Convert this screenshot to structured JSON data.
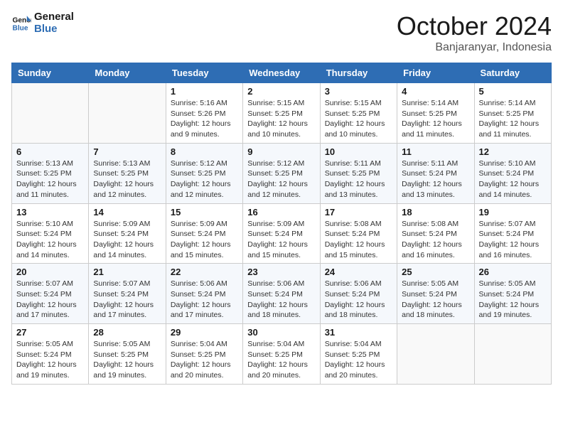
{
  "header": {
    "logo_general": "General",
    "logo_blue": "Blue",
    "month": "October 2024",
    "location": "Banjaranyar, Indonesia"
  },
  "weekdays": [
    "Sunday",
    "Monday",
    "Tuesday",
    "Wednesday",
    "Thursday",
    "Friday",
    "Saturday"
  ],
  "weeks": [
    [
      {
        "day": "",
        "sunrise": "",
        "sunset": "",
        "daylight": ""
      },
      {
        "day": "",
        "sunrise": "",
        "sunset": "",
        "daylight": ""
      },
      {
        "day": "1",
        "sunrise": "Sunrise: 5:16 AM",
        "sunset": "Sunset: 5:26 PM",
        "daylight": "Daylight: 12 hours and 9 minutes."
      },
      {
        "day": "2",
        "sunrise": "Sunrise: 5:15 AM",
        "sunset": "Sunset: 5:25 PM",
        "daylight": "Daylight: 12 hours and 10 minutes."
      },
      {
        "day": "3",
        "sunrise": "Sunrise: 5:15 AM",
        "sunset": "Sunset: 5:25 PM",
        "daylight": "Daylight: 12 hours and 10 minutes."
      },
      {
        "day": "4",
        "sunrise": "Sunrise: 5:14 AM",
        "sunset": "Sunset: 5:25 PM",
        "daylight": "Daylight: 12 hours and 11 minutes."
      },
      {
        "day": "5",
        "sunrise": "Sunrise: 5:14 AM",
        "sunset": "Sunset: 5:25 PM",
        "daylight": "Daylight: 12 hours and 11 minutes."
      }
    ],
    [
      {
        "day": "6",
        "sunrise": "Sunrise: 5:13 AM",
        "sunset": "Sunset: 5:25 PM",
        "daylight": "Daylight: 12 hours and 11 minutes."
      },
      {
        "day": "7",
        "sunrise": "Sunrise: 5:13 AM",
        "sunset": "Sunset: 5:25 PM",
        "daylight": "Daylight: 12 hours and 12 minutes."
      },
      {
        "day": "8",
        "sunrise": "Sunrise: 5:12 AM",
        "sunset": "Sunset: 5:25 PM",
        "daylight": "Daylight: 12 hours and 12 minutes."
      },
      {
        "day": "9",
        "sunrise": "Sunrise: 5:12 AM",
        "sunset": "Sunset: 5:25 PM",
        "daylight": "Daylight: 12 hours and 12 minutes."
      },
      {
        "day": "10",
        "sunrise": "Sunrise: 5:11 AM",
        "sunset": "Sunset: 5:25 PM",
        "daylight": "Daylight: 12 hours and 13 minutes."
      },
      {
        "day": "11",
        "sunrise": "Sunrise: 5:11 AM",
        "sunset": "Sunset: 5:24 PM",
        "daylight": "Daylight: 12 hours and 13 minutes."
      },
      {
        "day": "12",
        "sunrise": "Sunrise: 5:10 AM",
        "sunset": "Sunset: 5:24 PM",
        "daylight": "Daylight: 12 hours and 14 minutes."
      }
    ],
    [
      {
        "day": "13",
        "sunrise": "Sunrise: 5:10 AM",
        "sunset": "Sunset: 5:24 PM",
        "daylight": "Daylight: 12 hours and 14 minutes."
      },
      {
        "day": "14",
        "sunrise": "Sunrise: 5:09 AM",
        "sunset": "Sunset: 5:24 PM",
        "daylight": "Daylight: 12 hours and 14 minutes."
      },
      {
        "day": "15",
        "sunrise": "Sunrise: 5:09 AM",
        "sunset": "Sunset: 5:24 PM",
        "daylight": "Daylight: 12 hours and 15 minutes."
      },
      {
        "day": "16",
        "sunrise": "Sunrise: 5:09 AM",
        "sunset": "Sunset: 5:24 PM",
        "daylight": "Daylight: 12 hours and 15 minutes."
      },
      {
        "day": "17",
        "sunrise": "Sunrise: 5:08 AM",
        "sunset": "Sunset: 5:24 PM",
        "daylight": "Daylight: 12 hours and 15 minutes."
      },
      {
        "day": "18",
        "sunrise": "Sunrise: 5:08 AM",
        "sunset": "Sunset: 5:24 PM",
        "daylight": "Daylight: 12 hours and 16 minutes."
      },
      {
        "day": "19",
        "sunrise": "Sunrise: 5:07 AM",
        "sunset": "Sunset: 5:24 PM",
        "daylight": "Daylight: 12 hours and 16 minutes."
      }
    ],
    [
      {
        "day": "20",
        "sunrise": "Sunrise: 5:07 AM",
        "sunset": "Sunset: 5:24 PM",
        "daylight": "Daylight: 12 hours and 17 minutes."
      },
      {
        "day": "21",
        "sunrise": "Sunrise: 5:07 AM",
        "sunset": "Sunset: 5:24 PM",
        "daylight": "Daylight: 12 hours and 17 minutes."
      },
      {
        "day": "22",
        "sunrise": "Sunrise: 5:06 AM",
        "sunset": "Sunset: 5:24 PM",
        "daylight": "Daylight: 12 hours and 17 minutes."
      },
      {
        "day": "23",
        "sunrise": "Sunrise: 5:06 AM",
        "sunset": "Sunset: 5:24 PM",
        "daylight": "Daylight: 12 hours and 18 minutes."
      },
      {
        "day": "24",
        "sunrise": "Sunrise: 5:06 AM",
        "sunset": "Sunset: 5:24 PM",
        "daylight": "Daylight: 12 hours and 18 minutes."
      },
      {
        "day": "25",
        "sunrise": "Sunrise: 5:05 AM",
        "sunset": "Sunset: 5:24 PM",
        "daylight": "Daylight: 12 hours and 18 minutes."
      },
      {
        "day": "26",
        "sunrise": "Sunrise: 5:05 AM",
        "sunset": "Sunset: 5:24 PM",
        "daylight": "Daylight: 12 hours and 19 minutes."
      }
    ],
    [
      {
        "day": "27",
        "sunrise": "Sunrise: 5:05 AM",
        "sunset": "Sunset: 5:24 PM",
        "daylight": "Daylight: 12 hours and 19 minutes."
      },
      {
        "day": "28",
        "sunrise": "Sunrise: 5:05 AM",
        "sunset": "Sunset: 5:25 PM",
        "daylight": "Daylight: 12 hours and 19 minutes."
      },
      {
        "day": "29",
        "sunrise": "Sunrise: 5:04 AM",
        "sunset": "Sunset: 5:25 PM",
        "daylight": "Daylight: 12 hours and 20 minutes."
      },
      {
        "day": "30",
        "sunrise": "Sunrise: 5:04 AM",
        "sunset": "Sunset: 5:25 PM",
        "daylight": "Daylight: 12 hours and 20 minutes."
      },
      {
        "day": "31",
        "sunrise": "Sunrise: 5:04 AM",
        "sunset": "Sunset: 5:25 PM",
        "daylight": "Daylight: 12 hours and 20 minutes."
      },
      {
        "day": "",
        "sunrise": "",
        "sunset": "",
        "daylight": ""
      },
      {
        "day": "",
        "sunrise": "",
        "sunset": "",
        "daylight": ""
      }
    ]
  ]
}
